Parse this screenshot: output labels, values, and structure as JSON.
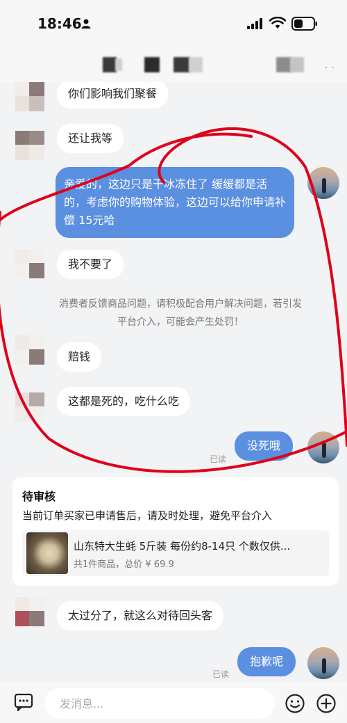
{
  "status": {
    "time": "18:46"
  },
  "messages": [
    {
      "text": "你们影响我们聚餐"
    },
    {
      "text": "还让我等"
    },
    {
      "text": "亲爱的，这边只是干冰冻住了 缓缓都是活的，考虑你的购物体验，这边可以给你申请补偿 15元哈"
    },
    {
      "text": "我不要了"
    },
    {
      "text": "赔钱"
    },
    {
      "text": "这都是死的，吃什么吃"
    },
    {
      "text": "没死哦",
      "read": "已读"
    },
    {
      "text": "太过分了，就这么对待回头客"
    },
    {
      "text": "抱歉呢",
      "read": "已读"
    }
  ],
  "notice": {
    "line1": "消费者反馈商品问题，请积极配合用户解决问题，若引发",
    "line2": "平台介入，可能会产生处罚！"
  },
  "order_card": {
    "title": "待审核",
    "description": "当前订单买家已申请售后，请及时处理，避免平台介入",
    "product_name": "山东特大生蚝 5斤装 每份约8-14只 个数仅供...",
    "product_meta": "共1件商品，总价 ¥ 69.9"
  },
  "input": {
    "placeholder": "发消息..."
  },
  "colors": {
    "accent": "#5b8fe0",
    "annotation": "#e0001b"
  }
}
